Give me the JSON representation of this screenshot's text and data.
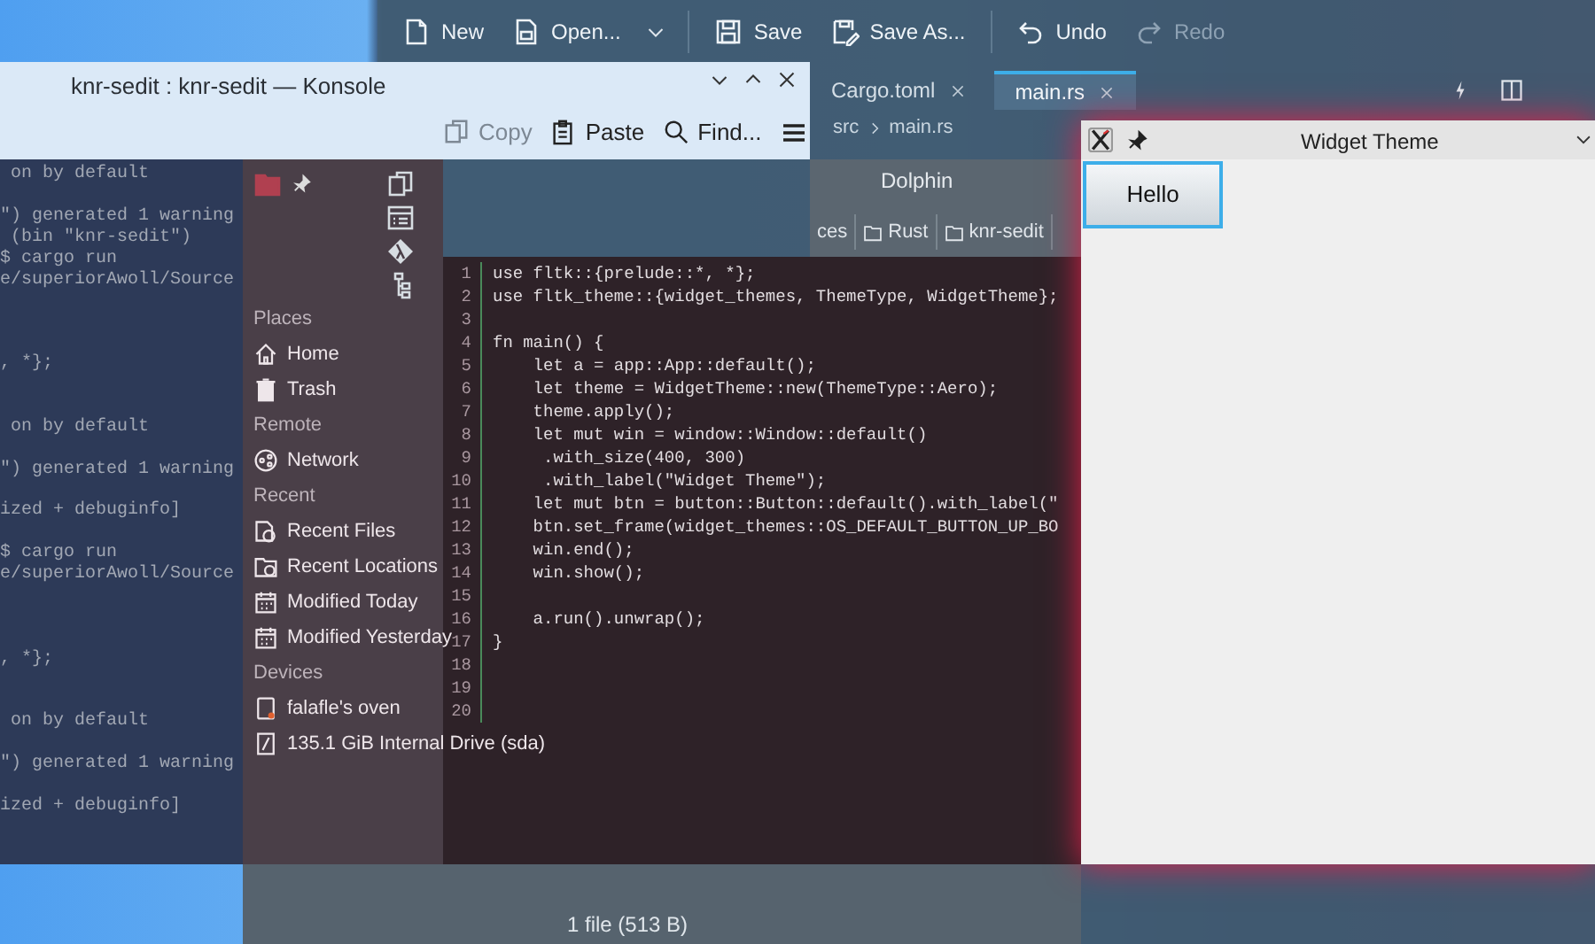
{
  "kate": {
    "toolbar": [
      {
        "label": "New",
        "disabled": false
      },
      {
        "label": "Open...",
        "disabled": false
      },
      {
        "label": "Save",
        "disabled": false
      },
      {
        "label": "Save As...",
        "disabled": false
      },
      {
        "label": "Undo",
        "disabled": false
      },
      {
        "label": "Redo",
        "disabled": true
      }
    ],
    "tabs": [
      {
        "label": "Cargo.toml",
        "selected": false
      },
      {
        "label": "main.rs",
        "selected": true
      }
    ],
    "breadcrumb": [
      "src",
      "main.rs"
    ],
    "code": [
      {
        "number": "1",
        "text": "use fltk::{prelude::*, *};"
      },
      {
        "number": "2",
        "text": "use fltk_theme::{widget_themes, ThemeType, WidgetTheme};"
      },
      {
        "number": "3"
      },
      {
        "number": "4",
        "text": "fn main() {"
      },
      {
        "number": "5",
        "text": "    let a = app::App::default();"
      },
      {
        "number": "6",
        "text": "    let theme = WidgetTheme::new(ThemeType::Aero);"
      },
      {
        "number": "7",
        "text": "    theme.apply();"
      },
      {
        "number": "8",
        "text": "    let mut win = window::Window::default()"
      },
      {
        "number": "9",
        "text": "     .with_size(400, 300)"
      },
      {
        "number": "10",
        "text": "     .with_label(\"Widget Theme\");"
      },
      {
        "number": "11",
        "text": "    let mut btn = button::Button::default().with_label(\""
      },
      {
        "number": "12",
        "text": "    btn.set_frame(widget_themes::OS_DEFAULT_BUTTON_UP_BO"
      },
      {
        "number": "13",
        "text": "    win.end();"
      },
      {
        "number": "14",
        "text": "    win.show();"
      },
      {
        "number": "15"
      },
      {
        "number": "16",
        "text": "    a.run().unwrap();"
      },
      {
        "number": "17",
        "text": "}"
      },
      {
        "number": "18"
      },
      {
        "number": "19"
      },
      {
        "number": "20"
      }
    ]
  },
  "dolphin": {
    "title": "Dolphin",
    "breadcrumb": [
      "ces",
      "Rust",
      "knr-sedit"
    ],
    "sidebar": [
      {
        "heading": "Places",
        "items": [
          "Home",
          "Trash"
        ]
      },
      {
        "heading": "Remote",
        "items": [
          "Network"
        ]
      },
      {
        "heading": "Recent",
        "items": [
          "Recent Files",
          "Recent Locations",
          "Modified Today",
          "Modified Yesterday"
        ]
      },
      {
        "heading": "Devices",
        "items": [
          "falafle's oven",
          "135.1 GiB Internal Drive (sda)"
        ]
      }
    ],
    "status": "1 file (513 B)"
  },
  "konsole": {
    "title": "knr-sedit : knr-sedit — Konsole",
    "toolbar": [
      {
        "label": "Copy",
        "disabled": true
      },
      {
        "label": "Paste",
        "disabled": false
      },
      {
        "label": "Find...",
        "disabled": false
      }
    ],
    "lines": [
      " on by default",
      "\") generated 1 warning",
      " (bin \"knr-sedit\")",
      "$ cargo run",
      "e/superiorAwoll/Source",
      ", *};",
      " on by default",
      "\") generated 1 warning",
      "ized + debuginfo]",
      "$ cargo run",
      "e/superiorAwoll/Source",
      ", *};",
      " on by default",
      "\") generated 1 warning",
      "ized + debuginfo]"
    ]
  },
  "widget_window": {
    "title": "Widget Theme",
    "button": "Hello"
  }
}
